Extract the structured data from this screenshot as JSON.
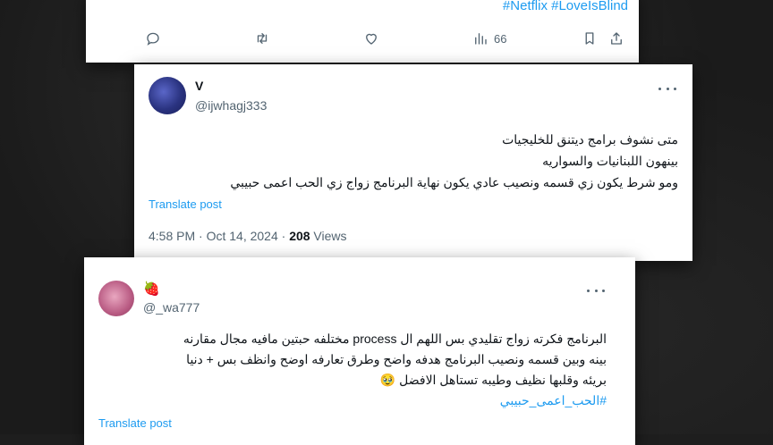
{
  "tweet_top": {
    "hashtags": "#Netflix #LoveIsBlind",
    "views_count": "66",
    "icons": [
      "reply-icon",
      "retweet-icon",
      "like-icon",
      "views-icon",
      "bookmark-icon",
      "share-icon"
    ]
  },
  "tweet_main": {
    "display_name": "V",
    "handle": "@ijwhagj333",
    "lines": [
      "متى نشوف برامج ديتنق للخليجيات",
      "بينهون اللبنانيات والسواريه",
      "ومو شرط يكون زي قسمه ونصيب عادي يكون نهاية البرنامج زواج زي الحب اعمى حبيبي"
    ],
    "translate_label": "Translate post",
    "time": "4:58 PM · Oct 14, 2024 · ",
    "views_count": "208",
    "views_label": " Views"
  },
  "tweet_reply": {
    "display_name_emoji": "🍓",
    "handle": "@_wa777",
    "lines": [
      "البرنامج فكرته زواج تقليدي بس اللهم ال process مختلفه حبتين مافيه مجال مقارنه",
      "بينه وبين قسمه ونصيب البرنامج هدفه واضح وطرق تعارفه اوضح وانظف بس + دنيا",
      "بريئه وقلبها نظيف وطيبه تستاهل الافضل 🥹"
    ],
    "hashtag": "#الحب_اعمى_حبيبي",
    "translate_label": "Translate post"
  },
  "colors": {
    "link": "#1d9bf0",
    "text_primary": "#0f1419",
    "text_secondary": "#536471"
  }
}
